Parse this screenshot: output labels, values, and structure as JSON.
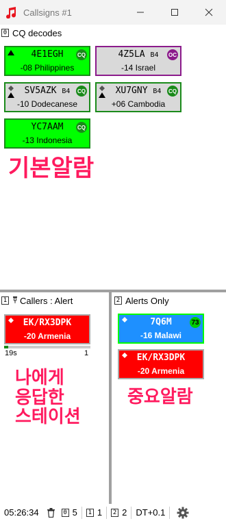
{
  "window": {
    "title": "Callsigns #1"
  },
  "panels": {
    "cq": {
      "num": "0",
      "title": "CQ decodes"
    },
    "callers": {
      "num": "1",
      "title": "Callers : Alert"
    },
    "alerts": {
      "num": "2",
      "title": "Alerts Only"
    }
  },
  "cq_tiles": [
    {
      "call": "4E1EGH",
      "band": "",
      "sub": "-08 Philippines",
      "badge": "CQ",
      "bg": "#00ff00",
      "border": "#1a8a1a",
      "badge_color": "#1a8a1a",
      "mark": "up"
    },
    {
      "call": "4Z5LA",
      "band": "B4",
      "sub": "-14 Israel",
      "badge": "OC",
      "bg": "#d9d9d9",
      "border": "#8b1a8b",
      "badge_color": "#8b1a8b",
      "mark": "none"
    },
    {
      "call": "SV5AZK",
      "band": "B4",
      "sub": "-10 Dodecanese",
      "badge": "CQ",
      "bg": "#d9d9d9",
      "border": "#1a8a1a",
      "badge_color": "#1a8a1a",
      "mark": "diamond-up"
    },
    {
      "call": "XU7GNY",
      "band": "B4",
      "sub": "+06 Cambodia",
      "badge": "CQ",
      "bg": "#d9d9d9",
      "border": "#1a8a1a",
      "badge_color": "#1a8a1a",
      "mark": "diamond-up"
    },
    {
      "call": "YC7AAM",
      "band": "",
      "sub": "-13 Indonesia",
      "badge": "CQ",
      "bg": "#00ff00",
      "border": "#1a8a1a",
      "badge_color": "#1a8a1a",
      "mark": "none"
    }
  ],
  "cq_annotation": "기본알람",
  "caller_tile": {
    "call": "EK/RX3DPK",
    "sub": "-20 Armenia",
    "bg": "#ff0000",
    "border": "#aaaaaa"
  },
  "caller_progress": {
    "elapsed": "19s",
    "count": "1",
    "fraction": 0.05
  },
  "caller_annotation": [
    "나에게",
    "응답한",
    "스테이션"
  ],
  "alert_tiles": [
    {
      "call": "7Q6M",
      "sub": "-16 Malawi",
      "badge": "73",
      "bg": "#1e90ff",
      "border": "#00ff00",
      "badge_color": "#00cc00"
    },
    {
      "call": "EK/RX3DPK",
      "sub": "-20 Armenia",
      "badge": "",
      "bg": "#ff0000",
      "border": "#aaaaaa",
      "badge_color": ""
    }
  ],
  "alerts_annotation": "중요알람",
  "statusbar": {
    "time": "05:26:34",
    "p0_num": "0",
    "p0_count": "5",
    "p1_num": "1",
    "p1_count": "1",
    "p2_num": "2",
    "p2_count": "2",
    "dt": "DT+0.1"
  },
  "colors": {
    "accent_red": "#e8141e",
    "annotation_pink": "#ff1a5e"
  }
}
